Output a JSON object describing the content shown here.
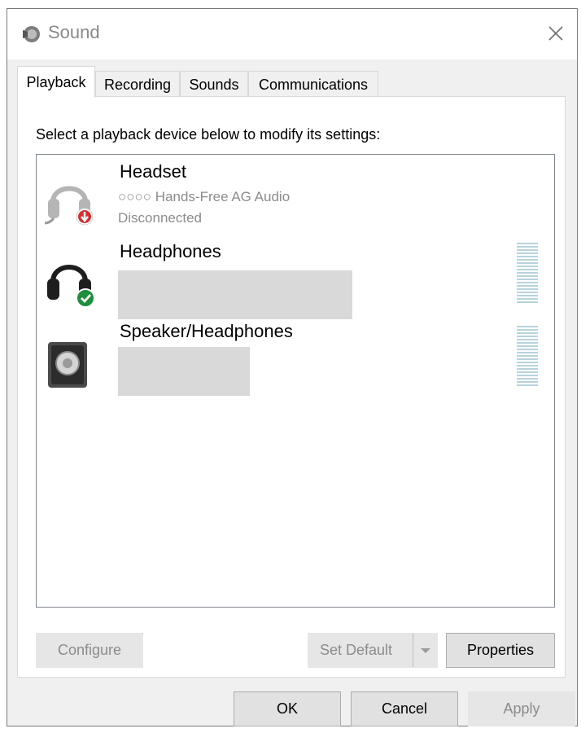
{
  "window": {
    "title": "Sound"
  },
  "tabs": [
    {
      "label": "Playback"
    },
    {
      "label": "Recording"
    },
    {
      "label": "Sounds"
    },
    {
      "label": "Communications"
    }
  ],
  "playback": {
    "instruction": "Select a playback device below to modify its settings:",
    "devices": [
      {
        "name": "Headset",
        "line1": "○○○○ Hands-Free AG Audio",
        "line2": "Disconnected",
        "icon": "headset-disconnected-icon"
      },
      {
        "name": "Headphones",
        "line1": "",
        "line2": "",
        "icon": "headphones-default-icon"
      },
      {
        "name": "Speaker/Headphones",
        "line1": "",
        "line2": "",
        "icon": "speaker-icon"
      }
    ],
    "buttons": {
      "configure": "Configure",
      "set_default": "Set Default",
      "properties": "Properties"
    }
  },
  "dialog_buttons": {
    "ok": "OK",
    "cancel": "Cancel",
    "apply": "Apply"
  },
  "colors": {
    "accent_green": "#1e8f3c",
    "disconnect_red": "#d32f2f"
  }
}
